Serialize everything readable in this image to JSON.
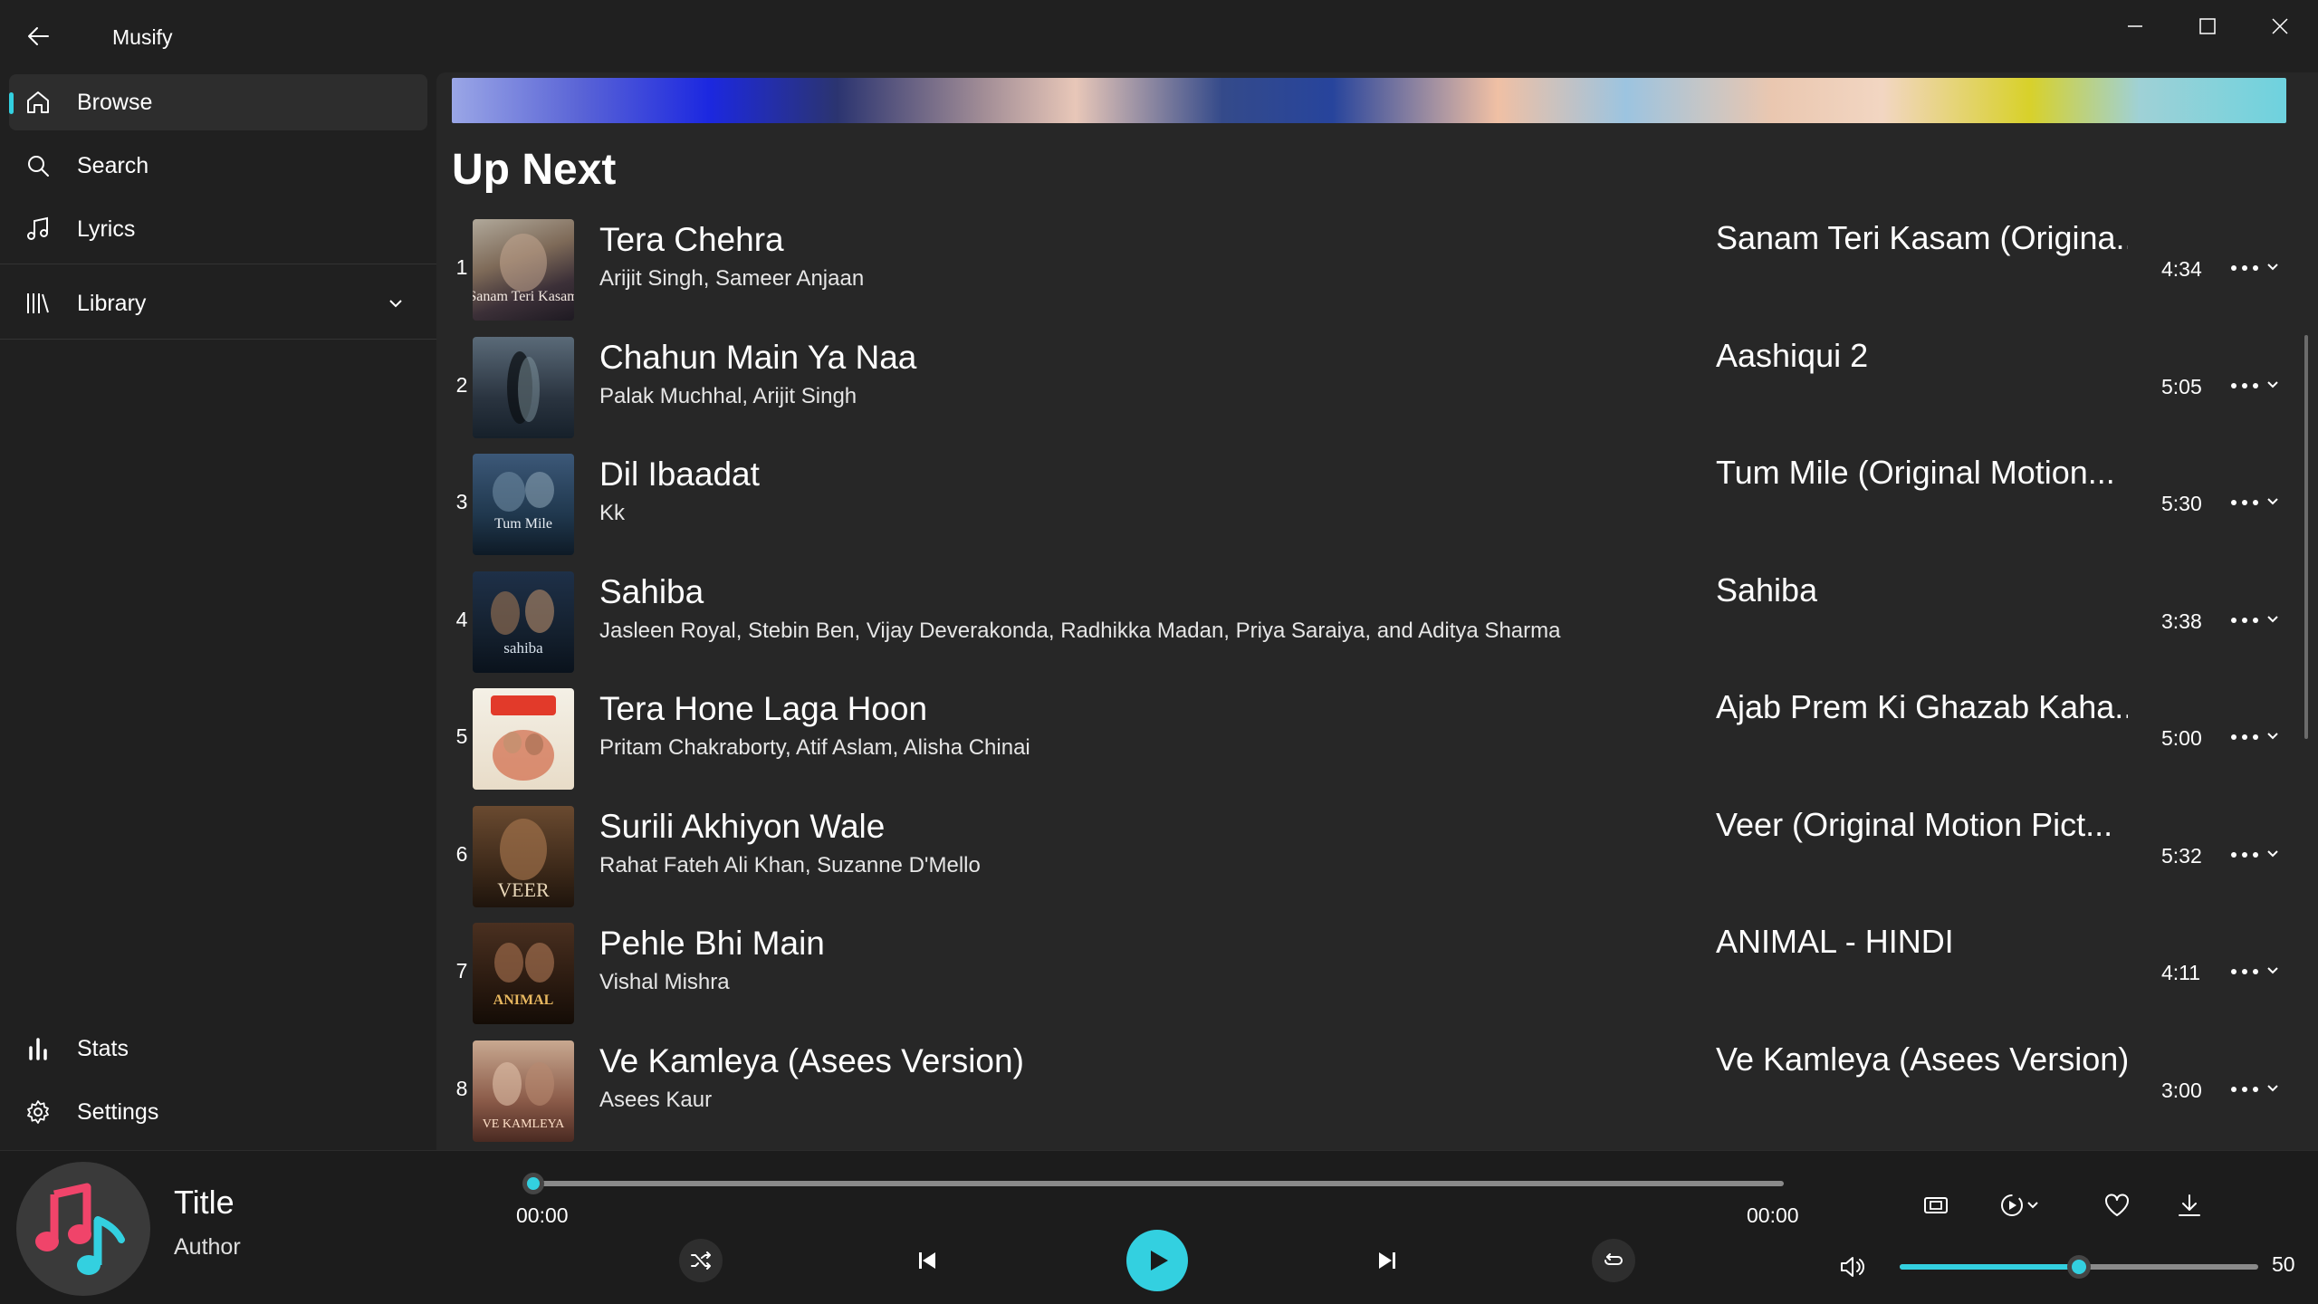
{
  "app": {
    "title": "Musify"
  },
  "window_controls": [
    "minimize",
    "maximize",
    "close"
  ],
  "sidebar": {
    "items": [
      {
        "label": "Browse",
        "icon": "home-icon",
        "active": true
      },
      {
        "label": "Search",
        "icon": "search-icon"
      },
      {
        "label": "Lyrics",
        "icon": "music-note-icon"
      },
      {
        "label": "Library",
        "icon": "library-icon",
        "expandable": true
      },
      {
        "label": "Stats",
        "icon": "bar-chart-icon"
      },
      {
        "label": "Settings",
        "icon": "gear-icon"
      }
    ]
  },
  "main": {
    "section_title": "Up Next",
    "tracks": [
      {
        "index": "1",
        "title": "Tera Chehra",
        "artist": "Arijit Singh, Sameer Anjaan",
        "album": "Sanam Teri Kasam (Origina...",
        "duration": "4:34",
        "art_label": "Sanam Teri Kasam"
      },
      {
        "index": "2",
        "title": "Chahun Main Ya Naa",
        "artist": "Palak Muchhal, Arijit Singh",
        "album": "Aashiqui 2",
        "duration": "5:05",
        "art_label": ""
      },
      {
        "index": "3",
        "title": "Dil Ibaadat",
        "artist": "Kk",
        "album": "Tum Mile (Original Motion...",
        "duration": "5:30",
        "art_label": "Tum Mile"
      },
      {
        "index": "4",
        "title": "Sahiba",
        "artist": "Jasleen Royal, Stebin Ben, Vijay Deverakonda, Radhikka Madan, Priya Saraiya, and Aditya Sharma",
        "album": "Sahiba",
        "duration": "3:38",
        "art_label": "sahiba"
      },
      {
        "index": "5",
        "title": "Tera Hone Laga Hoon",
        "artist": "Pritam Chakraborty, Atif Aslam, Alisha Chinai",
        "album": "Ajab Prem Ki Ghazab Kaha...",
        "duration": "5:00",
        "art_label": ""
      },
      {
        "index": "6",
        "title": "Surili Akhiyon Wale",
        "artist": "Rahat Fateh Ali Khan, Suzanne D'Mello",
        "album": "Veer (Original Motion Pict...",
        "duration": "5:32",
        "art_label": "VEER"
      },
      {
        "index": "7",
        "title": "Pehle Bhi Main",
        "artist": "Vishal Mishra",
        "album": "ANIMAL - HINDI",
        "duration": "4:11",
        "art_label": "ANIMAL"
      },
      {
        "index": "8",
        "title": "Ve Kamleya (Asees Version)",
        "artist": "Asees Kaur",
        "album": "Ve Kamleya (Asees Version)",
        "duration": "3:00",
        "art_label": "VE KAMLEYA"
      }
    ]
  },
  "player": {
    "title": "Title",
    "author": "Author",
    "current_time": "00:00",
    "total_time": "00:00",
    "progress": 0,
    "volume": "50",
    "volume_fraction": 0.5
  },
  "colors": {
    "accent": "#33d0e0",
    "background": "#202020",
    "content_background": "#272727",
    "player_background": "#1c1c1c"
  }
}
